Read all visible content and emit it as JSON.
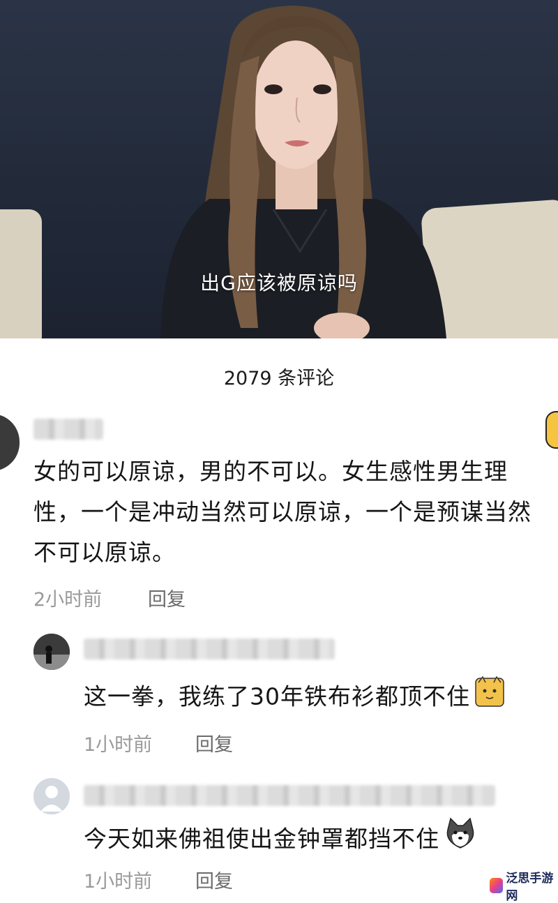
{
  "video": {
    "caption": "出G应该被原谅吗"
  },
  "comments_panel": {
    "count_label": "2079 条评论",
    "comments": [
      {
        "text": "女的可以原谅，男的不可以。女生感性男生理性，一个是冲动当然可以原谅，一个是预谋当然不可以原谅。",
        "time": "2小时前",
        "reply_label": "回复"
      }
    ],
    "replies": [
      {
        "text": "这一拳，我练了30年铁布衫都顶不住",
        "emoji_icon": "cat-face-icon",
        "time": "1小时前",
        "reply_label": "回复"
      },
      {
        "text": "今天如来佛祖使出金钟罩都挡不住",
        "emoji_icon": "dog-face-icon",
        "time": "1小时前",
        "reply_label": "回复"
      }
    ]
  },
  "watermark": {
    "text": "泛思手游网"
  },
  "colors": {
    "sheet_bg": "#ffffff",
    "text": "#161616",
    "meta": "#9a9a9a"
  }
}
